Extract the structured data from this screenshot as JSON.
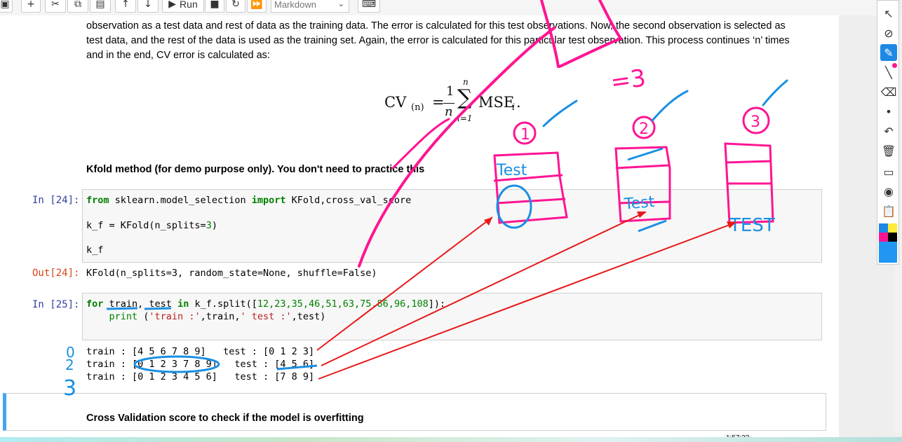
{
  "toolbar": {
    "run_label": "Run",
    "cell_type": "Markdown",
    "icons": [
      "save-icon",
      "insert-icon",
      "cut-icon",
      "copy-icon",
      "paste-icon",
      "move-up-icon",
      "move-down-icon",
      "run-icon",
      "stop-icon",
      "restart-icon",
      "fast-forward-icon",
      "keyboard-icon"
    ]
  },
  "markdown": {
    "line1": "observation as a test data and rest of data as the training data. The error is calculated for this test observations. Now, the second observation is selected as",
    "line2": "test data, and the rest of the data is used as the training set. Again, the error is calculated for this particular test observation. This process continues ‘n’ times",
    "line3": "and in the end, CV error is calculated as:",
    "formula": {
      "lhs": "CV",
      "lhs_sub": "(n)",
      "eq": "=",
      "frac_num": "1",
      "frac_den": "n",
      "sum_top": "n",
      "sum_bottom": "i=1",
      "term": "MSE",
      "term_sub": "i",
      "end": "."
    },
    "heading": "Kfold method (for demo purpose only). You don't need to practice this"
  },
  "cell24": {
    "prompt_in": "In [24]:",
    "line1_kw1": "from",
    "line1_mod": " sklearn.model_selection ",
    "line1_kw2": "import",
    "line1_rest": " KFold,cross_val_score",
    "line2_a": "k_f = KFold(n_splits=",
    "line2_num": "3",
    "line2_b": ")",
    "line3": "k_f",
    "prompt_out": "Out[24]:",
    "output": "KFold(n_splits=3, random_state=None, shuffle=False)"
  },
  "cell25": {
    "prompt_in": "In [25]:",
    "l1_kw1": "for",
    "l1_a": " train, test ",
    "l1_kw2": "in",
    "l1_b": " k_f.split([",
    "l1_nums": "12,23,35,46,51,63,75,86,96,108",
    "l1_c": "]):",
    "l2_indent": "    ",
    "l2_fn": "print",
    "l2_a": " (",
    "l2_s1": "'train :'",
    "l2_b": ",train,",
    "l2_s2": "' test :'",
    "l2_c": ",test)",
    "outputs": [
      "train : [4 5 6 7 8 9]   test : [0 1 2 3]",
      "train : [0 1 2 3 7 8 9]   test : [4 5 6]",
      "train : [0 1 2 3 4 5 6]   test : [7 8 9]"
    ]
  },
  "next_cell": {
    "heading": "Cross Validation score to check if the model is overfitting"
  },
  "timestamp": "1:57:22",
  "annotations": {
    "eq3": "=3",
    "fold_labels": [
      "1",
      "2",
      "3"
    ],
    "fold_text": [
      "Test",
      "Test",
      "TEST"
    ],
    "left_marks": [
      "0",
      "2",
      "3"
    ]
  },
  "sidepanel_tools": [
    "pointer-icon",
    "no-entry-icon",
    "highlighter-icon",
    "pen-icon",
    "eraser-icon",
    "dot-icon",
    "undo-icon",
    "trash-icon",
    "screen-icon",
    "camera-icon",
    "clipboard-icon"
  ],
  "colors": {
    "pink_ink": "#ff1493",
    "blue_ink": "#1a8fe3",
    "red_ink": "#e8191b",
    "cell_selected": "#42a5f5"
  }
}
